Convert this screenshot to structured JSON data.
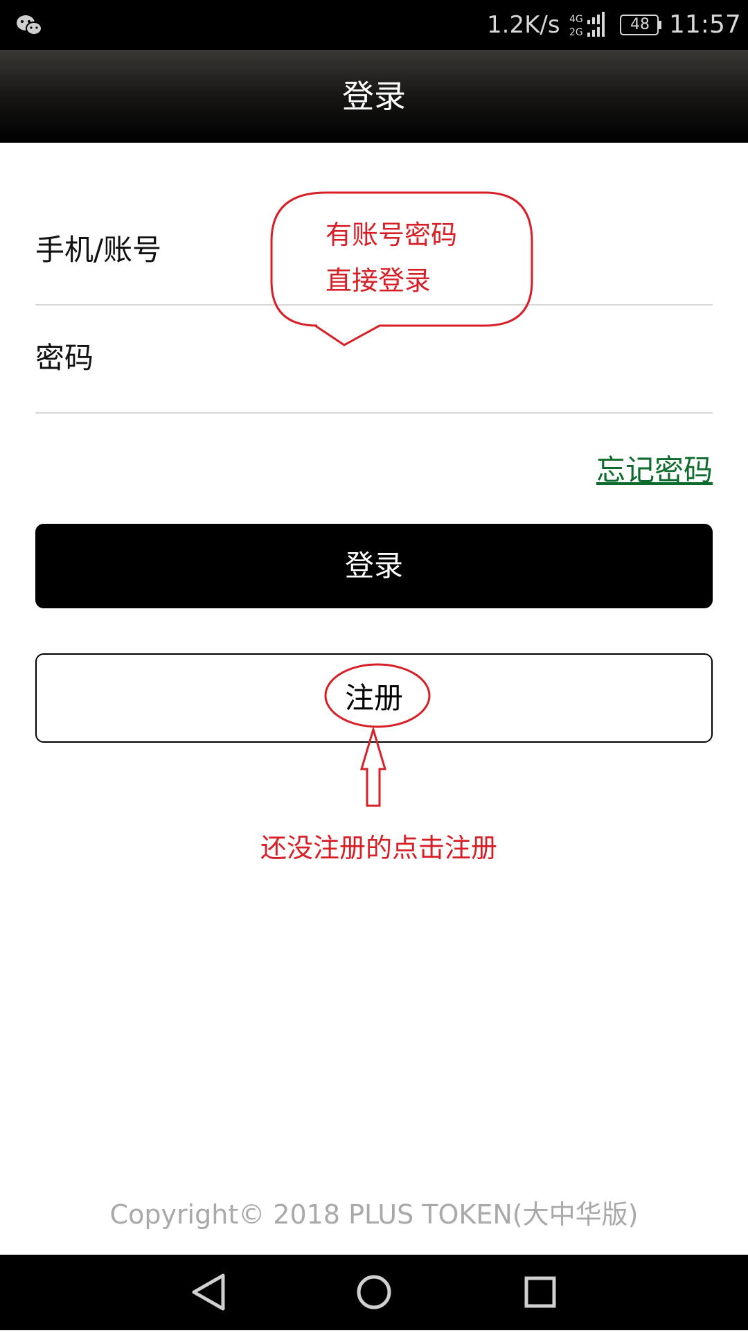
{
  "status_bar": {
    "network_speed": "1.2K/s",
    "signal_labels": [
      "4G",
      "2G"
    ],
    "battery": "48",
    "time": "11:57",
    "notification_icon": "wechat-icon"
  },
  "header": {
    "title": "登录"
  },
  "form": {
    "account_label": "手机/账号",
    "password_label": "密码",
    "forgot_password": "忘记密码",
    "login_button": "登录",
    "register_button": "注册"
  },
  "annotations": {
    "bubble_line1": "有账号密码",
    "bubble_line2": "直接登录",
    "register_hint": "还没注册的点击注册",
    "color": "#d61f26"
  },
  "footer": {
    "copyright": "Copyright© 2018 PLUS TOKEN(大中华版)"
  },
  "nav_bar": {
    "icons": [
      "back-icon",
      "home-icon",
      "recents-icon"
    ]
  },
  "colors": {
    "link_green": "#0d6b2c",
    "primary_black": "#000000"
  }
}
